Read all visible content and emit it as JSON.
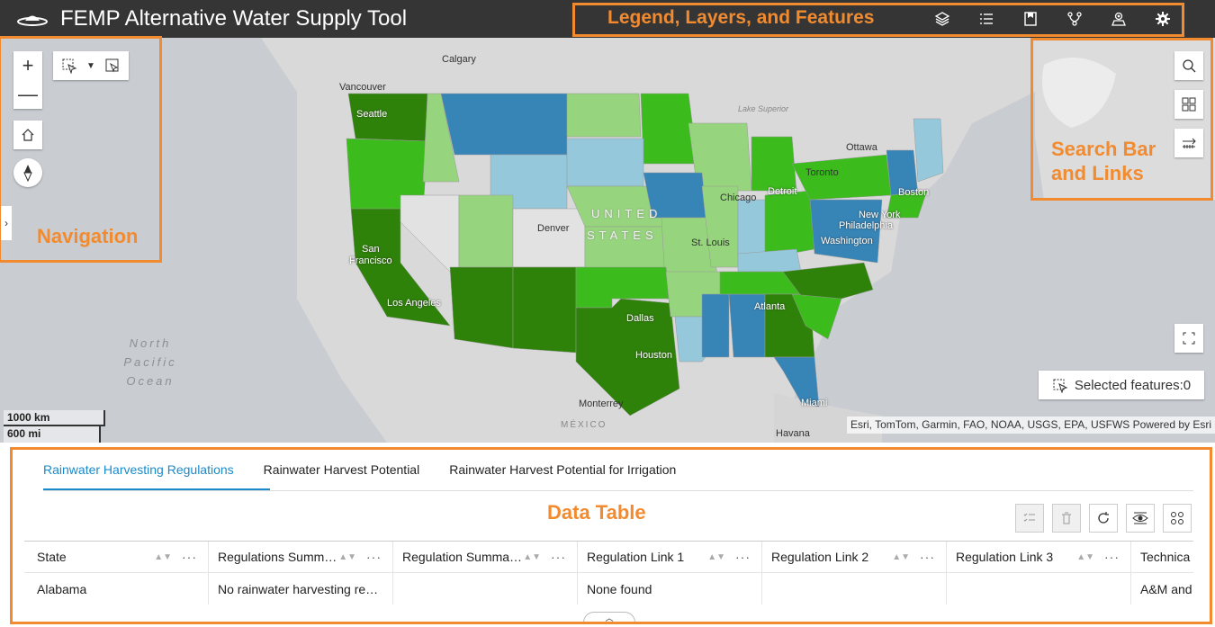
{
  "header": {
    "title": "FEMP Alternative Water Supply Tool",
    "icons": [
      "layers-icon",
      "legend-list-icon",
      "bookmark-icon",
      "network-icon",
      "map-pin-user-icon",
      "gear-icon"
    ]
  },
  "annotations": {
    "legend": "Legend, Layers, and Features",
    "navigation": "Navigation",
    "search_line1": "Search Bar",
    "search_line2": "and Links",
    "data_table": "Data Table",
    "accent_color": "#f28b2f"
  },
  "map": {
    "labels": {
      "calgary": "Calgary",
      "vancouver": "Vancouver",
      "seattle": "Seattle",
      "lake_superior": "Lake Superior",
      "ottawa": "Ottawa",
      "toronto": "Toronto",
      "detroit": "Detroit",
      "chicago": "Chicago",
      "boston": "Boston",
      "new_york": "New York",
      "philadelphia": "Philadelphia",
      "washington": "Washington",
      "denver": "Denver",
      "united": "UNITED",
      "states": "STATES",
      "st_louis": "St. Louis",
      "san_francisco_1": "San",
      "san_francisco_2": "Francisco",
      "los_angeles": "Los Angeles",
      "dallas": "Dallas",
      "atlanta": "Atlanta",
      "houston": "Houston",
      "miami": "Miami",
      "monterrey": "Monterrey",
      "mexico": "MÉXICO",
      "havana": "Havana",
      "north": "North",
      "pacific": "Pacific",
      "ocean": "Ocean"
    },
    "selected_features": "Selected features:0",
    "attribution": "Esri, TomTom, Garmin, FAO, NOAA, USGS, EPA, USFWS   Powered by Esri",
    "scale_km": "1000 km",
    "scale_mi": "600 mi",
    "colors": {
      "dark_green": "#2e8209",
      "green": "#3cbb1d",
      "light_green": "#96d47d",
      "blue": "#3785b7",
      "light_blue": "#96c8dc",
      "gray": "#e2e2e2"
    }
  },
  "table": {
    "tabs": [
      "Rainwater Harvesting Regulations",
      "Rainwater Harvest Potential",
      "Rainwater Harvest Potential for Irrigation"
    ],
    "columns": [
      "State",
      "Regulations Summ…",
      "Regulation Summa…",
      "Regulation Link 1",
      "Regulation Link 2",
      "Regulation Link 3",
      "Technica"
    ],
    "rows": [
      [
        "Alabama",
        "No rainwater harvesting re…",
        "",
        "None found",
        "",
        "",
        "A&M and"
      ]
    ],
    "accent": "#1a8ac9"
  }
}
